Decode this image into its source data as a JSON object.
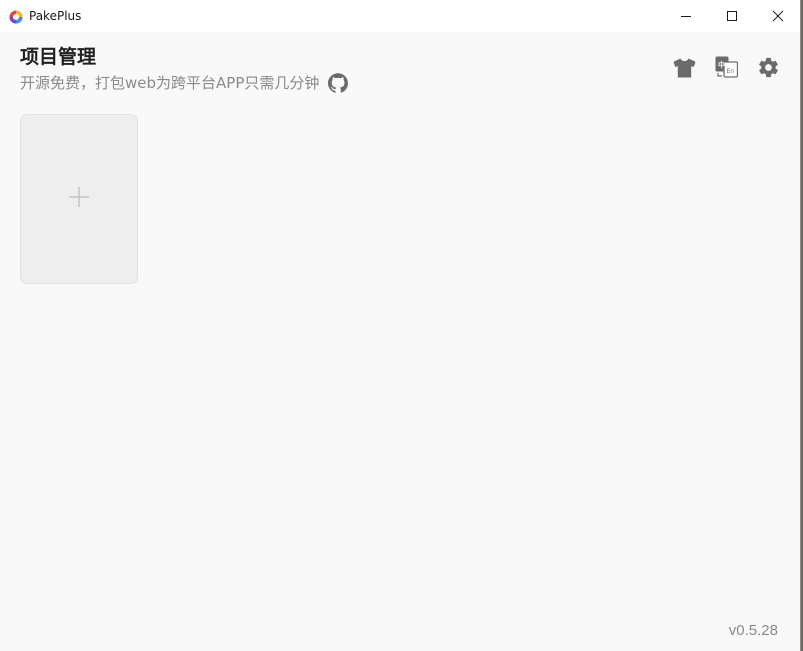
{
  "window": {
    "title": "PakePlus"
  },
  "header": {
    "title": "项目管理",
    "subtitle": "开源免费，打包web为跨平台APP只需几分钟"
  },
  "actions": {
    "icons": [
      "tshirt-icon",
      "translate-icon",
      "gear-icon"
    ]
  },
  "projects": {
    "add_card_icon": "plus-icon"
  },
  "footer": {
    "version": "v0.5.28"
  },
  "colors": {
    "background": "#f9f9f9",
    "titlebar": "#ffffff",
    "muted_text": "#8a8a8a",
    "icon_gray": "#6b6b6b",
    "card_bg": "#eeeeee"
  }
}
